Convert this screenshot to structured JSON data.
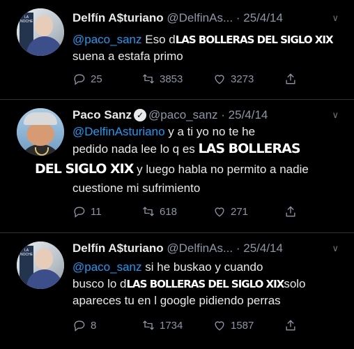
{
  "tweets": [
    {
      "name": "Delfín A$turiano",
      "handle": "@DelfinAs...",
      "date": "25/4/14",
      "mention": "@paco_sanz",
      "text_a": "Eso d",
      "overlay": "LAS BOLLERAS DEL SIGLO XIX",
      "text_b": "suena a estafa primo",
      "replies": "25",
      "retweets": "3853",
      "likes": "3273"
    },
    {
      "name": "Paco Sanz",
      "handle": "@paco_sanz",
      "date": "25/4/14",
      "mention": "@DelfinAsturiano",
      "text_a": "y a ti yo no te he",
      "text_b": "pedido nada lee lo q es",
      "overlay_a": "LAS BOLLERAS",
      "overlay_b": "DEL SIGLO XIX",
      "text_c": "y luego habla no permito a nadie",
      "text_d": "cuestione mi sufrimiento",
      "replies": "11",
      "retweets": "618",
      "likes": "271"
    },
    {
      "name": "Delfín A$turiano",
      "handle": "@DelfinAs...",
      "date": "25/4/14",
      "mention": "@paco_sanz",
      "text_a": "si he buskao y cuando",
      "text_b": "busco lo d",
      "overlay": "LAS BOLLERAS DEL SIGLO XIX",
      "text_c": "solo",
      "text_d": "apareces tu en l google pidiendo perras",
      "replies": "8",
      "retweets": "1734",
      "likes": "1587"
    }
  ],
  "icons": [
    "reply-icon",
    "retweet-icon",
    "like-icon",
    "share-icon",
    "caret-icon",
    "verified-badge-icon"
  ]
}
